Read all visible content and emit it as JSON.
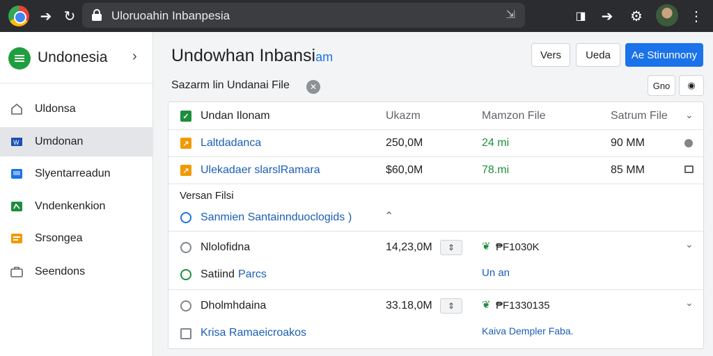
{
  "browser": {
    "url": "Uloruoahin Inbanpesia",
    "logo_colors": [
      "#ea4335",
      "#fbbc05",
      "#34a853",
      "#4285f4"
    ]
  },
  "sidebar": {
    "title": "Undonesia",
    "items": [
      {
        "label": "Uldonsa",
        "icon": "home-icon"
      },
      {
        "label": "Umdonan",
        "icon": "blue-file-icon",
        "active": true
      },
      {
        "label": "Slyentarreadun",
        "icon": "blue-square-icon"
      },
      {
        "label": "Vndenkenkion",
        "icon": "green-file-icon"
      },
      {
        "label": "Srsongea",
        "icon": "orange-file-icon"
      },
      {
        "label": "Seendons",
        "icon": "briefcase-icon"
      }
    ]
  },
  "main": {
    "title": "Undowhan Inbansi",
    "title_tail": "am",
    "subtitle": "Sazarm lin Undanai File",
    "buttons": {
      "vers": "Vers",
      "ueda": "Ueda",
      "primary": "Ae Stirunnony",
      "small": "Gno"
    },
    "header_row": {
      "name": "Undan Ilonam",
      "col2": "Ukazm",
      "col3": "Mamzon File",
      "col4": "Satrum File"
    },
    "files": [
      {
        "name": "Laltdadanca",
        "size": "250,0M",
        "extra": "24 mi",
        "right": "90 MM",
        "icon_color": "#f29900"
      },
      {
        "name": "Ulekadaer slarslRamara",
        "size": "$60,0M",
        "extra": "78.mi",
        "right": "85 MM",
        "icon_color": "#f29900"
      }
    ],
    "section_label": "Versan Filsi",
    "section_link": "Sanmien Santainnduoclogids",
    "section_link_tail": ")",
    "entries": [
      {
        "name": "Nlolofidna",
        "size": "14,23,0M",
        "value": "₱F1030K",
        "sub_label": "Satiind",
        "sub_link": "Parcs",
        "sub_value": "Un an"
      },
      {
        "name": "Dholmhdaina",
        "size": "33.18,0M",
        "value": "₱F1330135",
        "sub_link": "Krisa Ramaeicroakos",
        "sub_value": "Kaiva Dempler Faba."
      }
    ],
    "colors": {
      "accent": "#1a73e8",
      "green": "#1e8e3e",
      "orange": "#f29900"
    }
  }
}
